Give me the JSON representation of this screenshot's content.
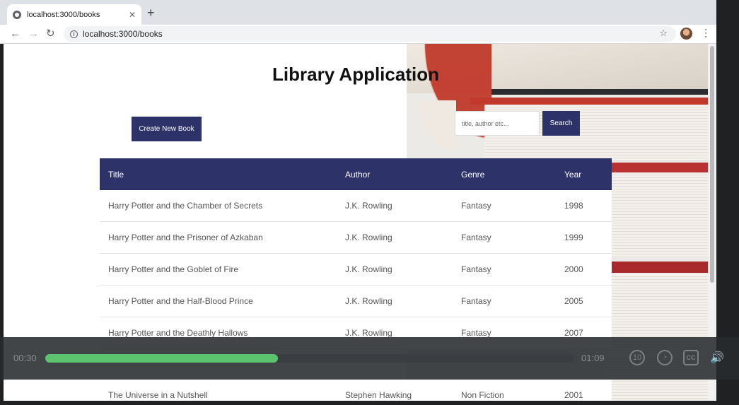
{
  "browser": {
    "tab_title": "localhost:3000/books",
    "tab_close": "✕",
    "new_tab": "+",
    "url": "localhost:3000/books",
    "back": "←",
    "forward": "→",
    "reload": "↻",
    "star": "☆",
    "menu": "⋮"
  },
  "page": {
    "title": "Library Application",
    "create_button": "Create New Book",
    "search_placeholder": "title, author etc...",
    "search_button": "Search",
    "columns": [
      "Title",
      "Author",
      "Genre",
      "Year"
    ],
    "rows": [
      [
        "Harry Potter and the Chamber of Secrets",
        "J.K. Rowling",
        "Fantasy",
        "1998"
      ],
      [
        "Harry Potter and the Prisoner of Azkaban",
        "J.K. Rowling",
        "Fantasy",
        "1999"
      ],
      [
        "Harry Potter and the Goblet of Fire",
        "J.K. Rowling",
        "Fantasy",
        "2000"
      ],
      [
        "Harry Potter and the Half-Blood Prince",
        "J.K. Rowling",
        "Fantasy",
        "2005"
      ],
      [
        "Harry Potter and the Deathly Hallows",
        "J.K. Rowling",
        "Fantasy",
        "2007"
      ]
    ],
    "rows_below": [
      [
        "The Universe in a Nutshell",
        "Stephen Hawking",
        "Non Fiction",
        "2001"
      ]
    ]
  },
  "player": {
    "current_time": "00:30",
    "duration": "01:09",
    "progress": 0.44,
    "rewind_label": "10",
    "cc_label": "CC",
    "volume_icon": "🔊"
  },
  "colors": {
    "accent": "#2d3268",
    "progress": "#5cc46e"
  }
}
